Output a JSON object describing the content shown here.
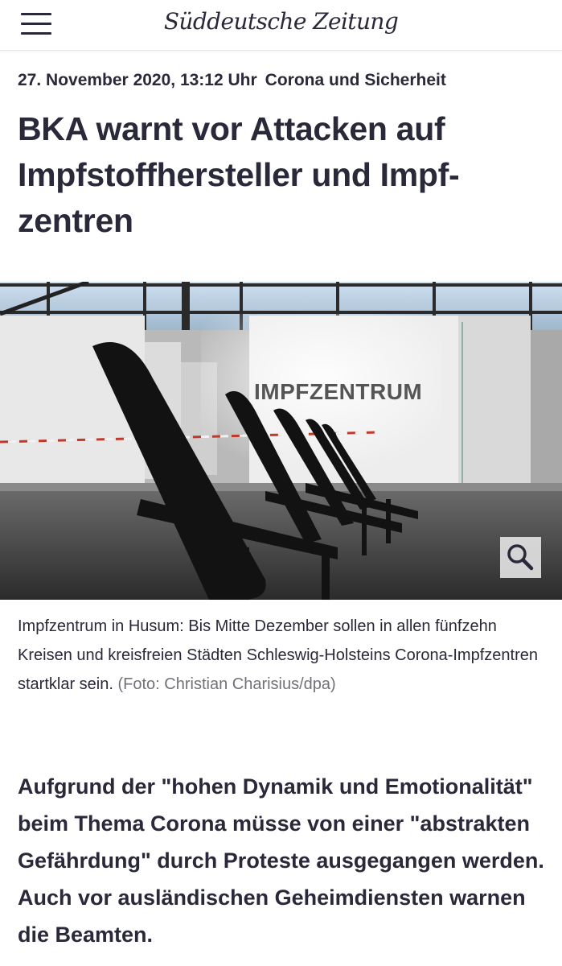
{
  "header": {
    "brand": "Süddeutsche Zeitung",
    "menu_icon": "hamburger-menu-icon"
  },
  "article": {
    "date": "27. November 2020, 13:12 Uhr",
    "topic": "Corona und Sicherheit",
    "headline": "BKA warnt vor Attacken auf Impfstoffhersteller und Impf­zentren",
    "image": {
      "sign_text": "IMPFZENTRUM",
      "zoom_icon": "magnifier-icon"
    },
    "caption": "Impfzentrum in Husum: Bis Mitte Dezember sollen in allen fünfzehn Kreisen und kreisfreien Städten Schleswig-Holsteins Corona-Impfzentren startklar sein.",
    "credit": "(Foto: Christian Charisius/dpa)",
    "lead": "Aufgrund der \"hohen Dynamik und Emotionalität\" beim Thema Corona müsse von einer \"abstrakten Gefährdung\" durch Proteste ausgegangen werden. Auch vor ausländischen Geheimdiensten warnen die Beamten."
  },
  "colors": {
    "text": "#29293a",
    "credit": "#71717a",
    "header_border": "#e6e6e6"
  }
}
